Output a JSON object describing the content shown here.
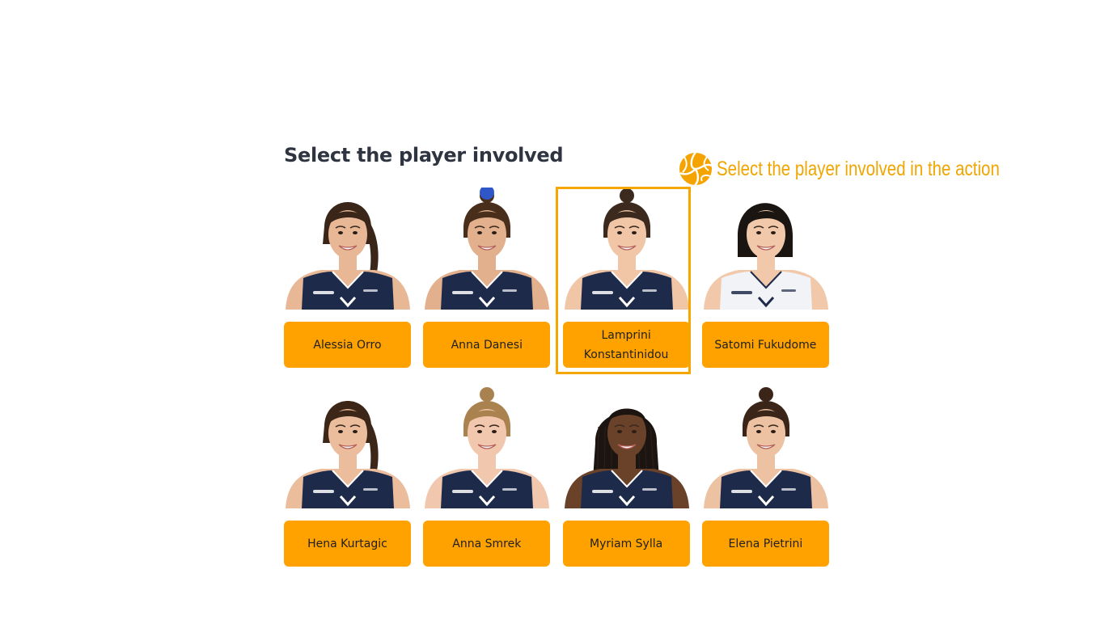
{
  "page": {
    "title": "Select the player involved"
  },
  "hint": {
    "text": "Select the player involved in the action",
    "icon": "volleyball-icon",
    "color": "#f0a500"
  },
  "colors": {
    "button": "#ffa200",
    "selection_border": "#f5a700",
    "jersey": "#1e2a4a",
    "jersey_white": "#f2f3f6"
  },
  "players": [
    {
      "name": "Alessia Orro",
      "selected": false,
      "skin": "#e8b896",
      "hair": "#3a2618",
      "hair_style": "ponytail",
      "jersey": "dark"
    },
    {
      "name": "Anna Danesi",
      "selected": false,
      "skin": "#e2b08c",
      "hair": "#4a2e1c",
      "hair_style": "bun",
      "jersey": "dark"
    },
    {
      "name": "Lamprini Konstantinidou",
      "selected": true,
      "skin": "#f0c6a6",
      "hair": "#3b2a1d",
      "hair_style": "bun",
      "jersey": "dark"
    },
    {
      "name": "Satomi Fukudome",
      "selected": false,
      "skin": "#f1c9aa",
      "hair": "#1b1512",
      "hair_style": "bob",
      "jersey": "white"
    },
    {
      "name": "Hena Kurtagic",
      "selected": false,
      "skin": "#ebbd9c",
      "hair": "#3b2618",
      "hair_style": "ponytail",
      "jersey": "dark"
    },
    {
      "name": "Anna Smrek",
      "selected": false,
      "skin": "#f1c7ad",
      "hair": "#a9824f",
      "hair_style": "bun",
      "jersey": "dark"
    },
    {
      "name": "Myriam Sylla",
      "selected": false,
      "skin": "#6a4129",
      "hair": "#1c1410",
      "hair_style": "braids",
      "jersey": "dark"
    },
    {
      "name": "Elena Pietrini",
      "selected": false,
      "skin": "#edc2a2",
      "hair": "#3a2518",
      "hair_style": "bun",
      "jersey": "dark"
    }
  ]
}
